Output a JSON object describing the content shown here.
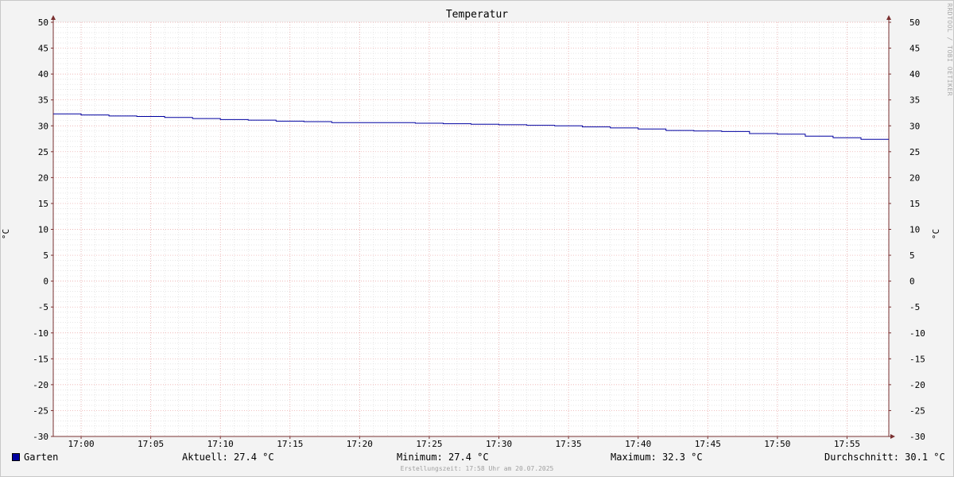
{
  "chart_data": {
    "type": "line",
    "title": "Temperatur",
    "ylabel": "°C",
    "ylim": [
      -30,
      50
    ],
    "y_ticks": [
      "50",
      "45",
      "40",
      "35",
      "30",
      "25",
      "20",
      "15",
      "10",
      "5",
      "0",
      "-5",
      "-10",
      "-15",
      "-20",
      "-25",
      "-30"
    ],
    "x_ticks": [
      "17:00",
      "17:05",
      "17:10",
      "17:15",
      "17:20",
      "17:25",
      "17:30",
      "17:35",
      "17:40",
      "17:45",
      "17:50",
      "17:55"
    ],
    "x_start": "16:58",
    "x_end": "17:58",
    "grid": true,
    "series": [
      {
        "name": "Garten",
        "color": "#0000a0",
        "step": true,
        "x": [
          "16:58",
          "17:00",
          "17:02",
          "17:04",
          "17:06",
          "17:08",
          "17:10",
          "17:12",
          "17:14",
          "17:16",
          "17:18",
          "17:20",
          "17:22",
          "17:24",
          "17:26",
          "17:28",
          "17:30",
          "17:32",
          "17:34",
          "17:36",
          "17:38",
          "17:40",
          "17:42",
          "17:44",
          "17:46",
          "17:48",
          "17:50",
          "17:52",
          "17:54",
          "17:56"
        ],
        "values": [
          32.3,
          32.1,
          31.9,
          31.8,
          31.6,
          31.4,
          31.2,
          31.1,
          30.9,
          30.8,
          30.6,
          30.6,
          30.6,
          30.5,
          30.4,
          30.3,
          30.2,
          30.1,
          30.0,
          29.8,
          29.6,
          29.4,
          29.1,
          29.0,
          28.9,
          28.5,
          28.4,
          28.0,
          27.7,
          27.4
        ]
      }
    ]
  },
  "legend": {
    "series_name": "Garten",
    "aktuell": "Aktuell: 27.4 °C",
    "minimum": "Minimum: 27.4 °C",
    "maximum": "Maximum: 32.3 °C",
    "durchschnitt": "Durchschnitt: 30.1 °C"
  },
  "footer": "Erstellungszeit: 17:58 Uhr am 20.07.2025",
  "watermark": "RRDTOOL / TOBI OETIKER",
  "colors": {
    "background": "#f3f3f3",
    "plot": "#ffffff",
    "major_grid": "#e9a0a0",
    "minor_grid": "#d8d8d8",
    "axis": "#7a3030",
    "line": "#0000a0"
  }
}
